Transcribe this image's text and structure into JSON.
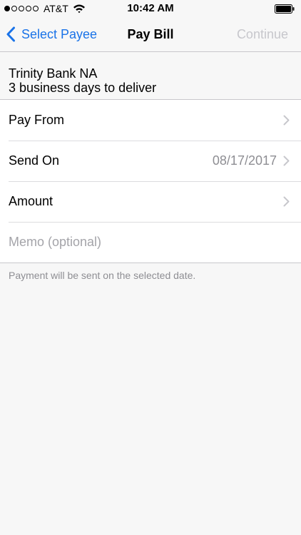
{
  "status_bar": {
    "carrier": "AT&T",
    "time": "10:42 AM"
  },
  "nav": {
    "back_label": "Select Payee",
    "title": "Pay Bill",
    "continue_label": "Continue",
    "accent_color": "#1a73e8"
  },
  "payee": {
    "name": "Trinity Bank NA",
    "delivery": "3 business days to deliver"
  },
  "form": {
    "pay_from_label": "Pay From",
    "send_on_label": "Send On",
    "send_on_value": "08/17/2017",
    "amount_label": "Amount",
    "memo_placeholder": "Memo (optional)"
  },
  "footnote": "Payment will be sent on the selected date."
}
